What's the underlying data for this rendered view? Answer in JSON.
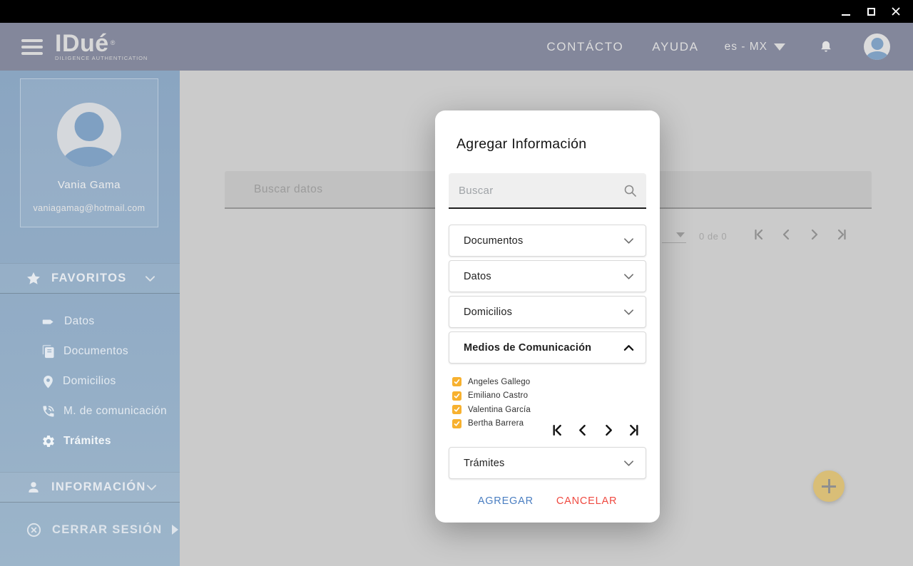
{
  "window": {
    "icons": {
      "minimize": "minimize-bar",
      "maximize": "square-outline",
      "close": "x-cross"
    }
  },
  "header": {
    "logo": {
      "text": "IDué",
      "registered": "®",
      "tagline": "DILIGENCE AUTHENTICATION"
    },
    "nav": [
      {
        "label": "CONTÁCTO"
      },
      {
        "label": "AYUDA"
      }
    ],
    "language": {
      "selected": "es - MX"
    },
    "icons": {
      "menu": "hamburger",
      "caret": "▼",
      "bell": "notification-bell",
      "avatar": "user-silhouette"
    }
  },
  "sidebar": {
    "profile": {
      "name": "Vania Gama",
      "email": "vaniagamag@hotmail.com"
    },
    "favorites": {
      "label": "FAVORITOS",
      "items": [
        {
          "label": "Datos",
          "icon": "tag-icon",
          "active": false
        },
        {
          "label": "Documentos",
          "icon": "documents-icon",
          "active": false
        },
        {
          "label": "Domicilios",
          "icon": "location-pin-icon",
          "active": false
        },
        {
          "label": "M. de comunicación",
          "icon": "phone-icon",
          "active": false
        },
        {
          "label": "Trámites",
          "icon": "gear-icon",
          "active": true
        }
      ]
    },
    "information": {
      "label": "INFORMACIÓN"
    },
    "logout": {
      "label": "CERRAR SESIÓN"
    }
  },
  "content": {
    "search_placeholder": "Buscar datos",
    "pagination": {
      "count": "0 de 0",
      "icons": [
        "first-page",
        "previous-page",
        "next-page",
        "last-page"
      ]
    },
    "fab_icon": "plus"
  },
  "modal": {
    "title": "Agregar Información",
    "search_placeholder": "Buscar",
    "accordions": [
      {
        "label": "Documentos",
        "expanded": false
      },
      {
        "label": "Datos",
        "expanded": false
      },
      {
        "label": "Domicilios",
        "expanded": false
      },
      {
        "label": "Medios de Comunicación",
        "expanded": true
      },
      {
        "label": "Trámites",
        "expanded": false
      }
    ],
    "communication_items": [
      {
        "label": "Angeles Gallego",
        "checked": true
      },
      {
        "label": "Emiliano Castro",
        "checked": true
      },
      {
        "label": "Valentina García",
        "checked": true
      },
      {
        "label": "Bertha Barrera",
        "checked": true
      }
    ],
    "pagination_icons": [
      "first-page",
      "previous-page",
      "next-page",
      "last-page"
    ],
    "buttons": {
      "confirm": "AGREGAR",
      "cancel": "CANCELAR"
    }
  },
  "theme": {
    "titlebar": "#000000",
    "header": "#83879B",
    "sidebar_top": "#8AA5C1",
    "sidebar_bottom": "#9CB5CA",
    "content_dimmed": "#CBCBCB",
    "modal_bg": "#FFFFFF",
    "checkbox_orange": "#F7B12F",
    "confirm_blue": "#4A7EC1",
    "cancel_red": "#EF4A41",
    "fab_gold": "#D9BE77",
    "avatar_blue": "#7FA0C2"
  }
}
